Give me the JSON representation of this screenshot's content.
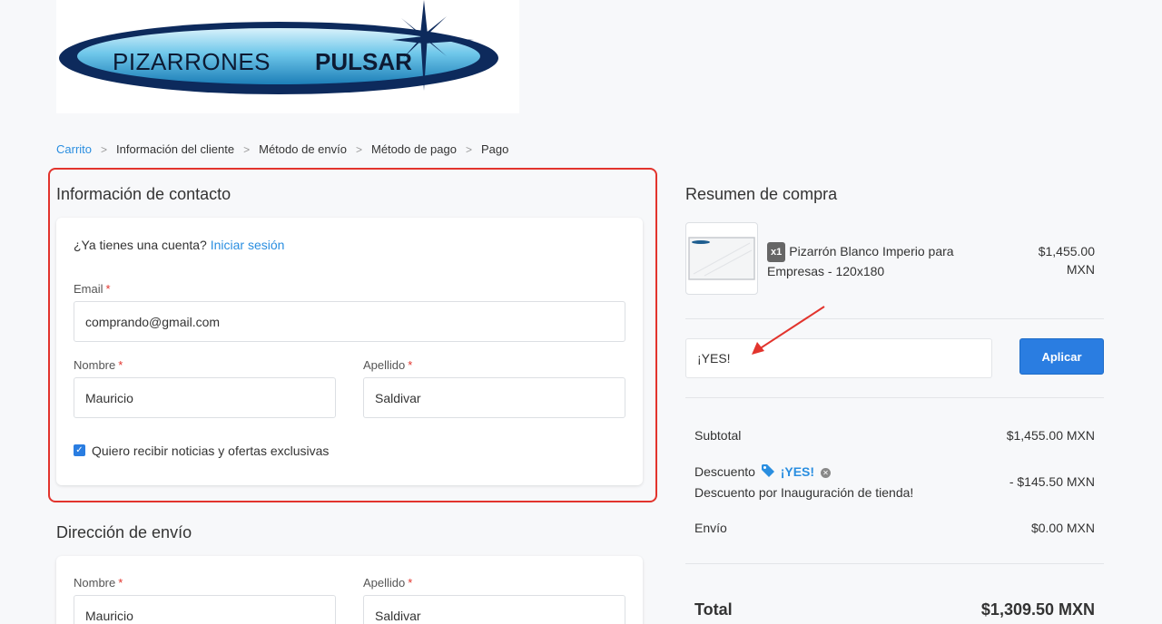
{
  "brand": {
    "logo_text_light": "PIZARRONES",
    "logo_text_bold": "PULSAR"
  },
  "breadcrumb": [
    {
      "label": "Carrito",
      "active": true
    },
    {
      "label": "Información del cliente",
      "active": false
    },
    {
      "label": "Método de envío",
      "active": false
    },
    {
      "label": "Método de pago",
      "active": false
    },
    {
      "label": "Pago",
      "active": false
    }
  ],
  "contact": {
    "title": "Información de contacto",
    "account_prompt": "¿Ya tienes una cuenta?",
    "login_link": "Iniciar sesión",
    "email_label": "Email",
    "email_value": "comprando@gmail.com",
    "first_name_label": "Nombre",
    "first_name_value": "Mauricio",
    "last_name_label": "Apellido",
    "last_name_value": "Saldivar",
    "newsletter_label": "Quiero recibir noticias y ofertas exclusivas",
    "newsletter_checked": true,
    "required_mark": "*"
  },
  "shipping": {
    "title": "Dirección de envío",
    "first_name_label": "Nombre",
    "first_name_value": "Mauricio",
    "last_name_label": "Apellido",
    "last_name_value": "Saldivar"
  },
  "summary": {
    "title": "Resumen de compra",
    "product": {
      "qty_badge": "x1",
      "name": "Pizarrón Blanco Imperio para Empresas - 120x180",
      "price_line1": "$1,455.00",
      "price_line2": "MXN"
    },
    "coupon_value": "¡YES!",
    "apply_label": "Aplicar",
    "subtotal_label": "Subtotal",
    "subtotal_value": "$1,455.00 MXN",
    "discount_label": "Descuento",
    "discount_code": "¡YES!",
    "discount_desc": "Descuento por Inauguración de tienda!",
    "discount_value": "- $145.50 MXN",
    "shipping_label": "Envío",
    "shipping_value": "$0.00 MXN",
    "total_label": "Total",
    "total_value": "$1,309.50 MXN"
  },
  "colors": {
    "accent": "#2a7de1",
    "link": "#2a8ee0",
    "highlight": "#e2342d",
    "required": "#e2342d"
  },
  "icons": [
    "tag-icon",
    "remove-icon",
    "check-icon",
    "chevron-right-icon",
    "arrow-annotation"
  ]
}
